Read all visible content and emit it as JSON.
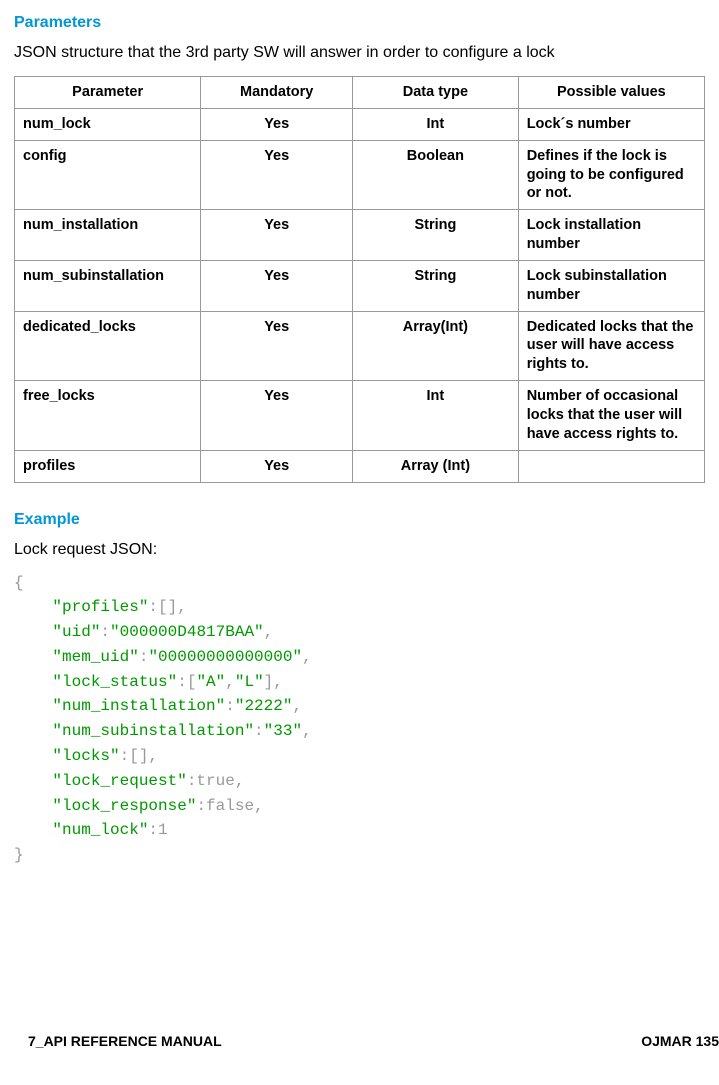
{
  "headings": {
    "parameters": "Parameters",
    "example": "Example"
  },
  "intro": "JSON structure that the 3rd party SW will answer in order to configure a lock",
  "table": {
    "headers": {
      "parameter": "Parameter",
      "mandatory": "Mandatory",
      "datatype": "Data type",
      "possible": "Possible values"
    },
    "rows": [
      {
        "param": "num_lock",
        "mandatory": "Yes",
        "datatype": "Int",
        "desc": "Lock´s number"
      },
      {
        "param": "config",
        "mandatory": "Yes",
        "datatype": "Boolean",
        "desc": "Defines if the lock is going to be configured or not."
      },
      {
        "param": "num_installation",
        "mandatory": "Yes",
        "datatype": "String",
        "desc": "Lock installation number"
      },
      {
        "param": "num_subinstallation",
        "mandatory": "Yes",
        "datatype": "String",
        "desc": "Lock subinstallation number"
      },
      {
        "param": "dedicated_locks",
        "mandatory": "Yes",
        "datatype": "Array(Int)",
        "desc": "Dedicated locks that the user will have access rights to."
      },
      {
        "param": "free_locks",
        "mandatory": "Yes",
        "datatype": "Int",
        "desc": "Number of occasional locks that the user will have access rights to."
      },
      {
        "param": "profiles",
        "mandatory": "Yes",
        "datatype": "Array (Int)",
        "desc": ""
      }
    ]
  },
  "example_label": "Lock request JSON:",
  "code": {
    "l0": "{",
    "l1a": "    ",
    "l1b": "\"profiles\"",
    "l1c": ":[],",
    "l2a": "    ",
    "l2b": "\"uid\"",
    "l2c": ":",
    "l2d": "\"000000D4817BAA\"",
    "l2e": ",",
    "l3a": "    ",
    "l3b": "\"mem_uid\"",
    "l3c": ":",
    "l3d": "\"00000000000000\"",
    "l3e": ",",
    "l4a": "    ",
    "l4b": "\"lock_status\"",
    "l4c": ":[",
    "l4d": "\"A\"",
    "l4e": ",",
    "l4f": "\"L\"",
    "l4g": "],",
    "l5a": "    ",
    "l5b": "\"num_installation\"",
    "l5c": ":",
    "l5d": "\"2222\"",
    "l5e": ",",
    "l6a": "    ",
    "l6b": "\"num_subinstallation\"",
    "l6c": ":",
    "l6d": "\"33\"",
    "l6e": ",",
    "l7a": "    ",
    "l7b": "\"locks\"",
    "l7c": ":[],",
    "l8a": "    ",
    "l8b": "\"lock_request\"",
    "l8c": ":true,",
    "l9a": "    ",
    "l9b": "\"lock_response\"",
    "l9c": ":false,",
    "l10a": "    ",
    "l10b": "\"num_lock\"",
    "l10c": ":1",
    "l11": "}"
  },
  "footer": {
    "left": "7_API REFERENCE MANUAL",
    "right": "OJMAR 135"
  }
}
